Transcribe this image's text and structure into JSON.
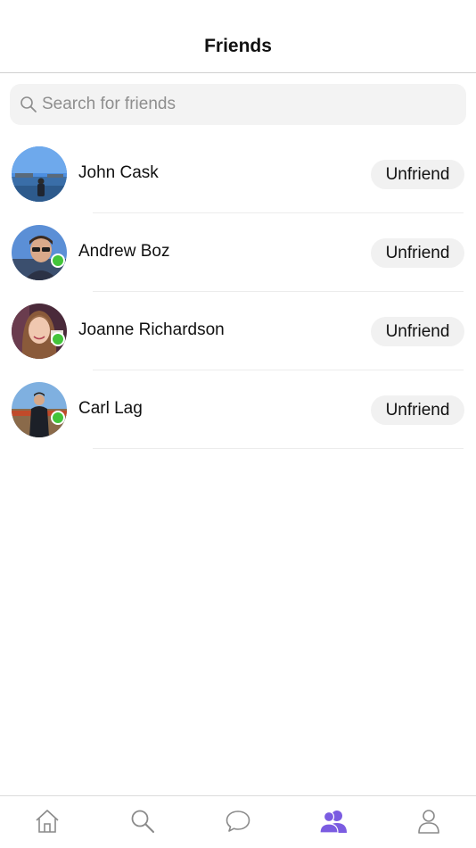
{
  "header": {
    "title": "Friends"
  },
  "search": {
    "placeholder": "Search for friends",
    "value": "",
    "icon": "search-icon"
  },
  "friends": [
    {
      "name": "John Cask",
      "online": false,
      "action_label": "Unfriend"
    },
    {
      "name": "Andrew Boz",
      "online": true,
      "action_label": "Unfriend"
    },
    {
      "name": "Joanne Richardson",
      "online": true,
      "action_label": "Unfriend"
    },
    {
      "name": "Carl Lag",
      "online": true,
      "action_label": "Unfriend"
    }
  ],
  "tabbar": {
    "tabs": [
      {
        "icon": "home-icon",
        "active": false
      },
      {
        "icon": "search-icon",
        "active": false
      },
      {
        "icon": "chat-bubble-icon",
        "active": false
      },
      {
        "icon": "friends-icon",
        "active": true
      },
      {
        "icon": "profile-icon",
        "active": false
      }
    ]
  },
  "colors": {
    "online": "#43c43a",
    "active_tab": "#7b5ce1",
    "inactive_tab": "#8a8a8a",
    "button_bg": "#f1f1f1",
    "search_bg": "#f3f3f3"
  }
}
